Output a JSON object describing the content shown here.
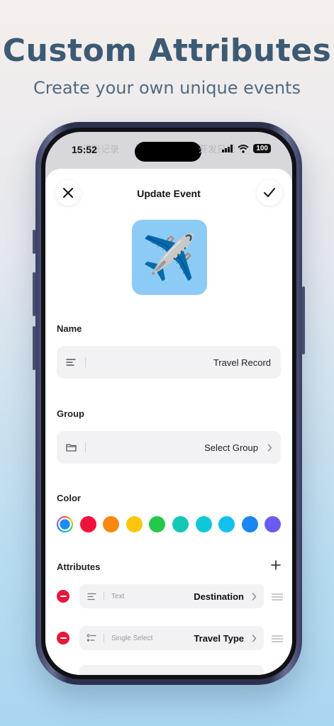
{
  "headline": "Custom Attributes",
  "subheadline": "Create your own unique events",
  "status_bar": {
    "time": "15:52",
    "ghost_left": "记账记录",
    "ghost_right": "开发日记",
    "battery": "100"
  },
  "sheet": {
    "title": "Update Event",
    "close_icon": "close-icon",
    "confirm_icon": "checkmark-icon",
    "emoji": "✈️",
    "emoji_tile_color": "#8dcbf7"
  },
  "name_section": {
    "label": "Name",
    "value": "Travel Record",
    "icon": "text-align-icon"
  },
  "group_section": {
    "label": "Group",
    "value": "Select Group",
    "icon": "folder-icon"
  },
  "color_section": {
    "label": "Color",
    "swatches": [
      "#1e8cf0",
      "#f0123a",
      "#f7870f",
      "#fcc60f",
      "#25c84a",
      "#13c8b4",
      "#0ec8d8",
      "#13c0ee",
      "#1a86f0",
      "#6a5cf0"
    ],
    "selected_index": 0
  },
  "attributes_section": {
    "label": "Attributes",
    "add_icon": "plus-icon",
    "items": [
      {
        "type": "Text",
        "name": "Destination",
        "icon": "text-align-icon"
      },
      {
        "type": "Single Select",
        "name": "Travel Type",
        "icon": "list-select-icon"
      }
    ]
  }
}
